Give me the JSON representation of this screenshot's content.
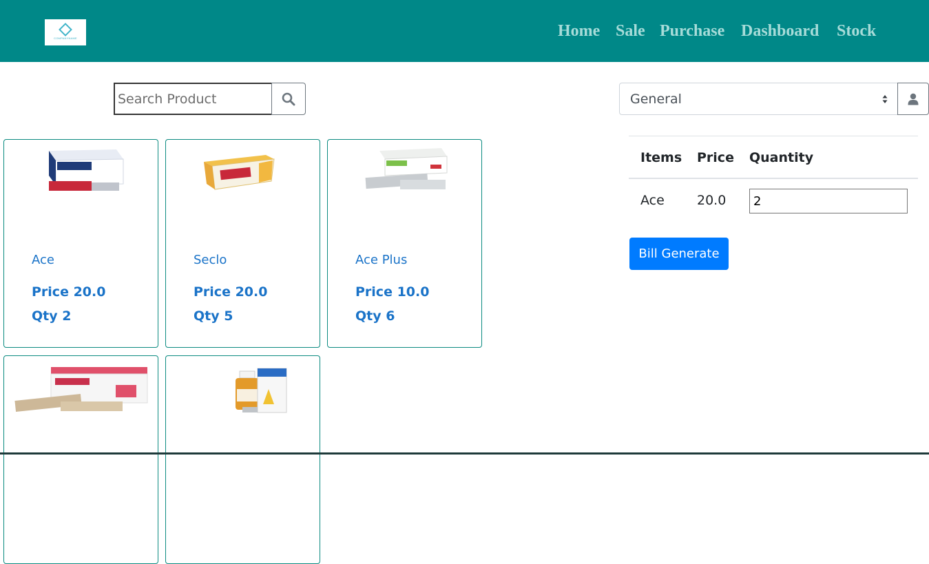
{
  "header": {
    "logo_text": "COMPANYNAME",
    "nav": [
      "Home",
      "Sale",
      "Purchase",
      "Dashboard",
      "Stock"
    ]
  },
  "search": {
    "placeholder": "Search Product",
    "icon": "search-icon"
  },
  "customer_select": {
    "selected": "General",
    "icon": "user-icon"
  },
  "products": [
    {
      "name": "Ace",
      "price": "Price 20.0",
      "qty": "Qty 2"
    },
    {
      "name": "Seclo",
      "price": "Price 20.0",
      "qty": "Qty 5"
    },
    {
      "name": "Ace Plus",
      "price": "Price 10.0",
      "qty": "Qty 6"
    },
    {
      "name": "",
      "price": "",
      "qty": ""
    },
    {
      "name": "",
      "price": "",
      "qty": ""
    }
  ],
  "cart": {
    "headers": [
      "Items",
      "Price",
      "Quantity"
    ],
    "rows": [
      {
        "item": "Ace",
        "price": "20.0",
        "quantity": "2"
      }
    ],
    "bill_button": "Bill Generate"
  },
  "colors": {
    "header_bg": "#008888",
    "nav_text": "#a7dcd9",
    "accent": "#007bff",
    "product_text": "#1a73c8",
    "card_border": "#0a8a80"
  }
}
